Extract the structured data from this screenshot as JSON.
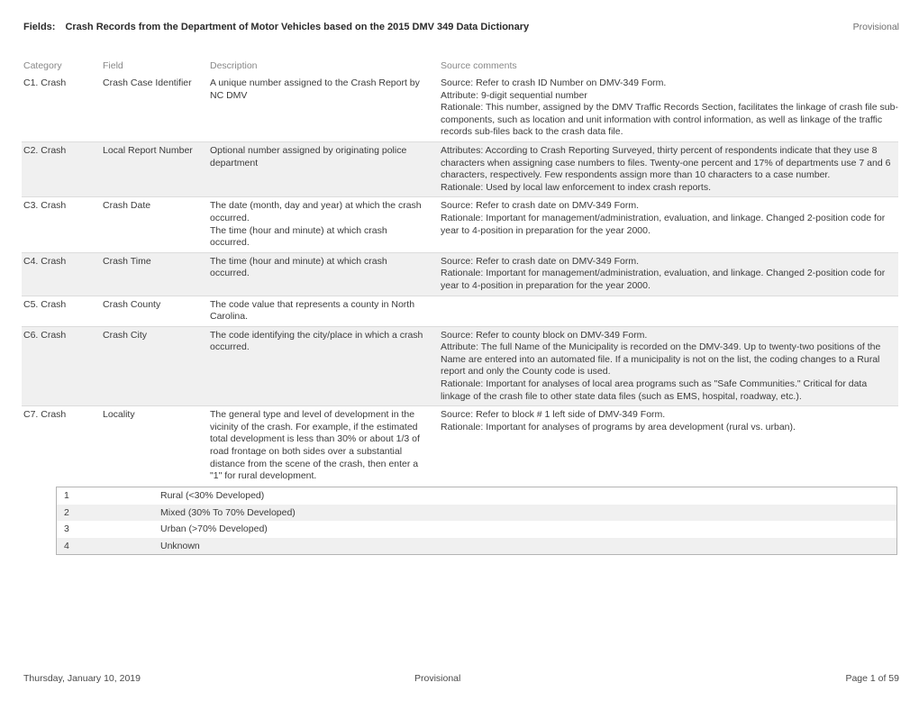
{
  "header": {
    "fields_label": "Fields:",
    "title": "Crash Records from the Department of Motor Vehicles based on the 2015 DMV 349 Data Dictionary",
    "status": "Provisional"
  },
  "table": {
    "columns": {
      "category": "Category",
      "field": "Field",
      "description": "Description",
      "source_comments": "Source comments"
    },
    "rows": [
      {
        "category": "C1. Crash",
        "field": "Crash Case Identifier",
        "description": "A unique number assigned to the Crash Report by NC DMV",
        "source_comments": "Source: Refer to crash ID Number on DMV-349 Form.\nAttribute: 9-digit sequential number\nRationale: This number, assigned by the DMV Traffic Records Section, facilitates the linkage of crash file sub-components, such as location and unit information with control information, as well as linkage of the traffic records sub-files back to the crash data file.",
        "shaded": false
      },
      {
        "category": "C2. Crash",
        "field": "Local Report Number",
        "description": "Optional number assigned by originating police department",
        "source_comments": "Attributes:   According to Crash Reporting Surveyed, thirty percent of respondents indicate that they use 8 characters when assigning case numbers to files. Twenty-one percent and 17% of departments use 7 and 6 characters, respectively. Few respondents assign more than 10 characters to a case number.\nRationale:   Used by local law enforcement to index crash reports.",
        "shaded": true
      },
      {
        "category": "C3. Crash",
        "field": "Crash Date",
        "description": "The date (month, day and year) at which the crash occurred.\nThe time (hour and minute) at which crash occurred.",
        "source_comments": "Source: Refer to crash date on DMV-349 Form.\nRationale: Important for management/administration, evaluation, and linkage. Changed 2-position code for year to 4-position in preparation for the year 2000.",
        "shaded": false
      },
      {
        "category": "C4. Crash",
        "field": "Crash Time",
        "description": "The time (hour and minute) at which crash occurred.",
        "source_comments": "Source: Refer to crash date on DMV-349 Form.\nRationale: Important for management/administration, evaluation, and linkage. Changed 2-position code for year to 4-position in preparation for the year 2000.",
        "shaded": true
      },
      {
        "category": "C5. Crash",
        "field": "Crash County",
        "description": "The code value that represents a county in North Carolina.",
        "source_comments": "",
        "shaded": false
      },
      {
        "category": "C6. Crash",
        "field": "Crash City",
        "description": "The code identifying the city/place in which a crash occurred.",
        "source_comments": "Source: Refer to county block on DMV-349 Form.\nAttribute: The full Name of the Municipality is recorded on the DMV-349. Up to twenty-two positions of the Name are entered into an automated file. If a municipality is not on the list, the coding changes to a Rural report and only the County code is used.\nRationale: Important for analyses of local area programs such as \"Safe Communities.\" Critical for data linkage of the crash file to other state data files (such as EMS, hospital, roadway, etc.).",
        "shaded": true
      },
      {
        "category": "C7. Crash",
        "field": "Locality",
        "description": "The general type and level of development in the vicinity of the crash. For example, if the estimated total development is less than 30% or about 1/3 of road frontage on both sides over a substantial distance from the scene of the crash, then enter a \"1\" for rural development.",
        "source_comments": "Source: Refer to block # 1 left side of DMV-349 Form.\nRationale: Important for analyses of programs by area development (rural vs. urban).",
        "shaded": false
      }
    ]
  },
  "code_table": {
    "rows": [
      {
        "code": "1",
        "label": "Rural (<30% Developed)",
        "shaded": false
      },
      {
        "code": "2",
        "label": "Mixed (30% To 70% Developed)",
        "shaded": true
      },
      {
        "code": "3",
        "label": "Urban (>70% Developed)",
        "shaded": false
      },
      {
        "code": "4",
        "label": "Unknown",
        "shaded": true
      }
    ]
  },
  "footer": {
    "date": "Thursday, January 10, 2019",
    "status": "Provisional",
    "page": "Page 1 of 59"
  },
  "colors": {
    "page_background": "#ffffff",
    "body_text": "#3b3b3b",
    "header_text": "#2b2b2b",
    "column_header_text": "#888888",
    "row_shade": "#f0f0f0",
    "rule": "#dcdcdc",
    "code_table_border": "#b4b4b4"
  }
}
